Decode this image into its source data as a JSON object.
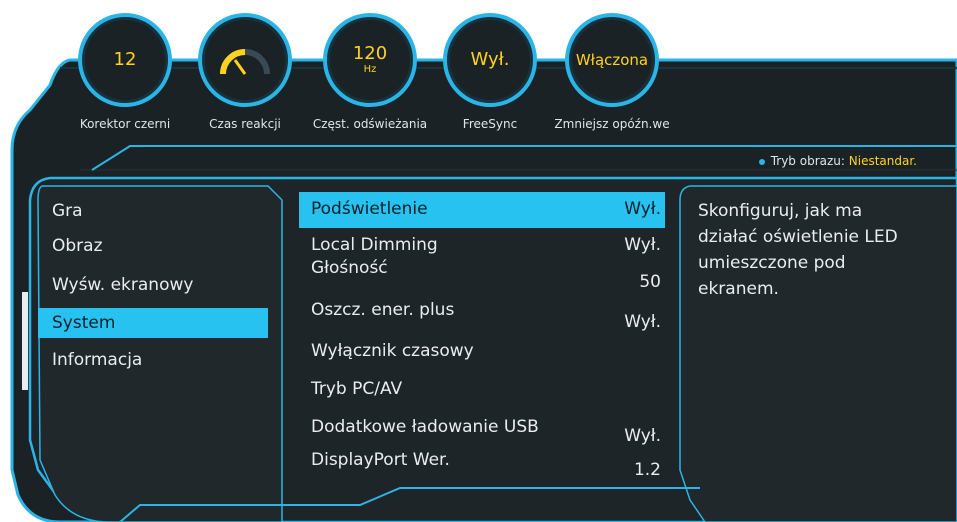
{
  "gauges": [
    {
      "value": "12",
      "unit": "",
      "label": "Korektor czerni",
      "icon": ""
    },
    {
      "value": "",
      "unit": "",
      "label": "Czas reakcji",
      "icon": "response-time-dial-icon"
    },
    {
      "value": "120",
      "unit": "Hz",
      "label": "Częst. odświeżania",
      "icon": ""
    },
    {
      "value": "Wył.",
      "unit": "",
      "label": "FreeSync",
      "icon": ""
    },
    {
      "value": "Włączona",
      "unit": "",
      "label": "Zmniejsz opóźn.we",
      "icon": ""
    }
  ],
  "status": {
    "prefix": "Tryb obrazu:",
    "value": "Niestandar."
  },
  "menu": {
    "items": [
      "Gra",
      "Obraz",
      "Wyśw. ekranowy",
      "System",
      "Informacja"
    ],
    "selected": "System"
  },
  "submenu": {
    "rows": [
      {
        "label": "Podświetlenie",
        "value": "Wył."
      },
      {
        "label": "Local Dimming",
        "value": "Wył."
      },
      {
        "label": "Głośność",
        "value": "50"
      },
      {
        "label": "Oszcz. ener. plus",
        "value": "Wył."
      },
      {
        "label": "Wyłącznik czasowy",
        "value": ""
      },
      {
        "label": "Tryb PC/AV",
        "value": ""
      },
      {
        "label": "Dodatkowe ładowanie USB",
        "value": "Wył."
      },
      {
        "label": "DisplayPort Wer.",
        "value": "1.2"
      }
    ],
    "selected": "Podświetlenie"
  },
  "description": "Skonfiguruj, jak ma działać oświetlenie LED umieszczone pod ekranem.",
  "colors": {
    "accent": "#27c2f0",
    "panel": "#1b2226",
    "value_yellow": "#ffd21f",
    "frame": "#28a9d8"
  }
}
